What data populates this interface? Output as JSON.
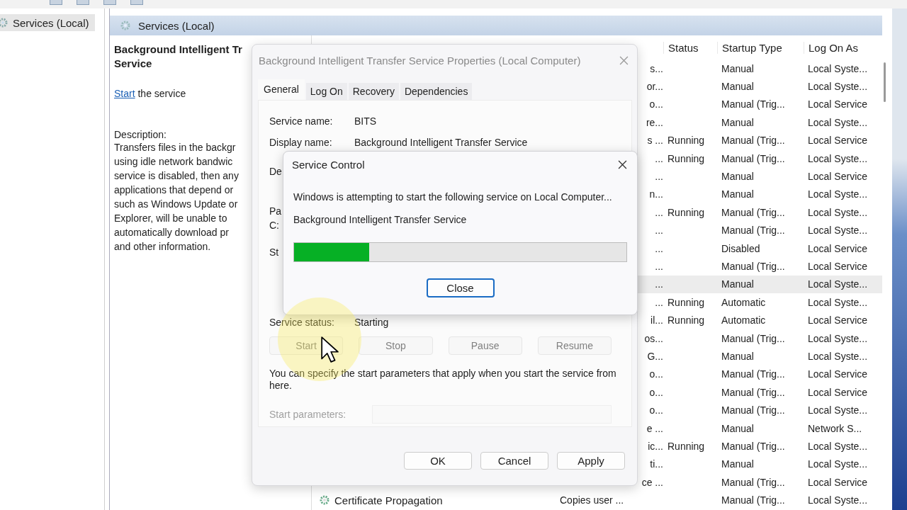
{
  "tree": {
    "items": [
      {
        "label": "Services (Local)",
        "selected": true
      }
    ]
  },
  "panel": {
    "title": "Services (Local)"
  },
  "details": {
    "title_lines": [
      "Background Intelligent Tr",
      "Service"
    ],
    "link": "Start",
    "link_rest": "the service",
    "description_label": "Description:",
    "description_lines": [
      "Transfers files in the backgr",
      "using idle network bandwic",
      "service is disabled, then any",
      "applications that depend or",
      "such as Windows Update or",
      "Explorer, will be unable to",
      "automatically download pr",
      "and other information."
    ]
  },
  "services": {
    "columns": [
      "Status",
      "Startup Type",
      "Log On As"
    ],
    "rows": [
      {
        "description": "s...",
        "startup_type": "Manual",
        "log_on_as": "Local Syste...",
        "selected": false
      },
      {
        "description": "or...",
        "startup_type": "Manual",
        "log_on_as": "Local Syste...",
        "selected": false
      },
      {
        "description": "o...",
        "startup_type": "Manual (Trig...",
        "log_on_as": "Local Service",
        "selected": false
      },
      {
        "description": "re...",
        "startup_type": "Manual",
        "log_on_as": "Local Syste...",
        "selected": false
      },
      {
        "description": "s ...",
        "status": "Running",
        "startup_type": "Manual (Trig...",
        "log_on_as": "Local Service",
        "selected": false
      },
      {
        "description": "...",
        "status": "Running",
        "startup_type": "Manual (Trig...",
        "log_on_as": "Local Syste...",
        "selected": false
      },
      {
        "description": "...",
        "startup_type": "Manual",
        "log_on_as": "Local Service",
        "selected": false
      },
      {
        "description": "n...",
        "startup_type": "Manual",
        "log_on_as": "Local Syste...",
        "selected": false
      },
      {
        "description": "...",
        "status": "Running",
        "startup_type": "Manual (Trig...",
        "log_on_as": "Local Syste...",
        "selected": false
      },
      {
        "description": "...",
        "startup_type": "Manual (Trig...",
        "log_on_as": "Local Syste...",
        "selected": false
      },
      {
        "description": "...",
        "startup_type": "Disabled",
        "log_on_as": "Local Service",
        "selected": false
      },
      {
        "description": "...",
        "startup_type": "Manual (Trig...",
        "log_on_as": "Local Service",
        "selected": false
      },
      {
        "description": "...",
        "startup_type": "Manual",
        "log_on_as": "Local Syste...",
        "selected": true
      },
      {
        "description": "...",
        "status": "Running",
        "startup_type": "Automatic",
        "log_on_as": "Local Syste...",
        "selected": false
      },
      {
        "description": "il...",
        "status": "Running",
        "startup_type": "Automatic",
        "log_on_as": "Local Service",
        "selected": false
      },
      {
        "description": "os...",
        "startup_type": "Manual (Trig...",
        "log_on_as": "Local Syste...",
        "selected": false
      },
      {
        "description": "G...",
        "startup_type": "Manual",
        "log_on_as": "Local Syste...",
        "selected": false
      },
      {
        "description": "o...",
        "startup_type": "Manual (Trig...",
        "log_on_as": "Local Service",
        "selected": false
      },
      {
        "description": "o...",
        "startup_type": "Manual (Trig...",
        "log_on_as": "Local Service",
        "selected": false
      },
      {
        "description": "o...",
        "startup_type": "Manual (Trig...",
        "log_on_as": "Local Syste...",
        "selected": false
      },
      {
        "description": "e ...",
        "startup_type": "Manual",
        "log_on_as": "Network S...",
        "selected": false
      },
      {
        "description": "ic...",
        "status": "Running",
        "startup_type": "Manual (Trig...",
        "log_on_as": "Local Syste...",
        "selected": false
      },
      {
        "description": "ti...",
        "startup_type": "Manual",
        "log_on_as": "Local Syste...",
        "selected": false
      },
      {
        "description": "ce ...",
        "startup_type": "Manual (Trig...",
        "log_on_as": "Local Service",
        "selected": false
      },
      {
        "name": "Certificate Propagation",
        "description": "Copies user ...",
        "startup_type": "Manual (Trig...",
        "log_on_as": "Local Syste...",
        "selected": false
      }
    ]
  },
  "properties_dialog": {
    "title": "Background Intelligent Transfer Service Properties (Local Computer)",
    "tabs": [
      {
        "label": "General",
        "selected": true
      },
      {
        "label": "Log On",
        "selected": false
      },
      {
        "label": "Recovery",
        "selected": false
      },
      {
        "label": "Dependencies",
        "selected": false
      }
    ],
    "fields": [
      {
        "label": "Service name:",
        "value": "BITS"
      },
      {
        "label": "Display name:",
        "value": "Background Intelligent Transfer Service"
      }
    ],
    "covered_labels": [
      "De",
      "Pa",
      "C:",
      "St"
    ],
    "status_label": "Service status:",
    "status_value": "Starting",
    "control_buttons": [
      {
        "label": "Start",
        "disabled": true
      },
      {
        "label": "Stop",
        "disabled": true
      },
      {
        "label": "Pause",
        "disabled": true
      },
      {
        "label": "Resume",
        "disabled": true
      }
    ],
    "note": "You can specify the start parameters that apply when you start the service from here.",
    "params_label": "Start parameters:",
    "params_disabled": true,
    "buttons": [
      "OK",
      "Cancel",
      "Apply"
    ]
  },
  "service_control": {
    "title": "Service Control",
    "message": "Windows is attempting to start the following service on Local Computer...",
    "service": "Background Intelligent Transfer Service",
    "level": 0.225,
    "button": "Close"
  }
}
